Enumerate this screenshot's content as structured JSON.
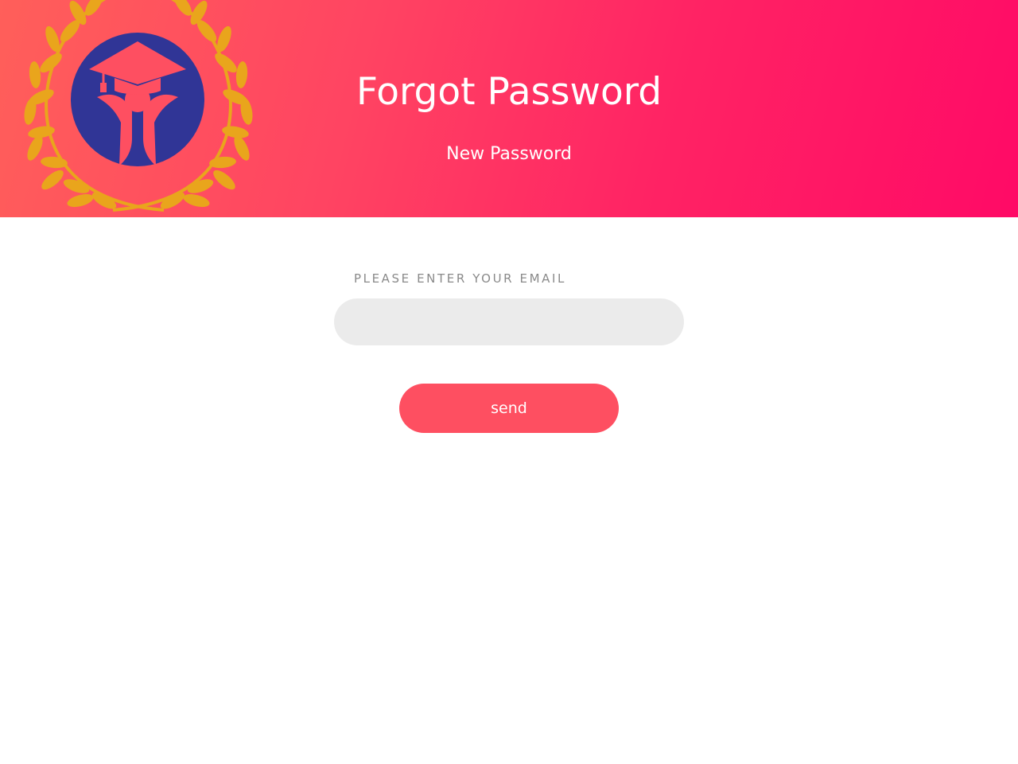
{
  "header": {
    "title": "Forgot Password",
    "subtitle": "New Password",
    "gradient_start": "#ff5f5a",
    "gradient_end": "#ff0a66"
  },
  "logo": {
    "icon": "graduation-laurel-logo-icon",
    "wreath_color": "#e9a51c",
    "emblem_color": "#303596",
    "accent_color": "#fe4f61"
  },
  "form": {
    "email_label": "PLEASE ENTER YOUR EMAIL",
    "email_value": "",
    "email_placeholder": "",
    "send_label": "send",
    "button_color": "#fe4f61",
    "input_background": "#ebebeb"
  }
}
